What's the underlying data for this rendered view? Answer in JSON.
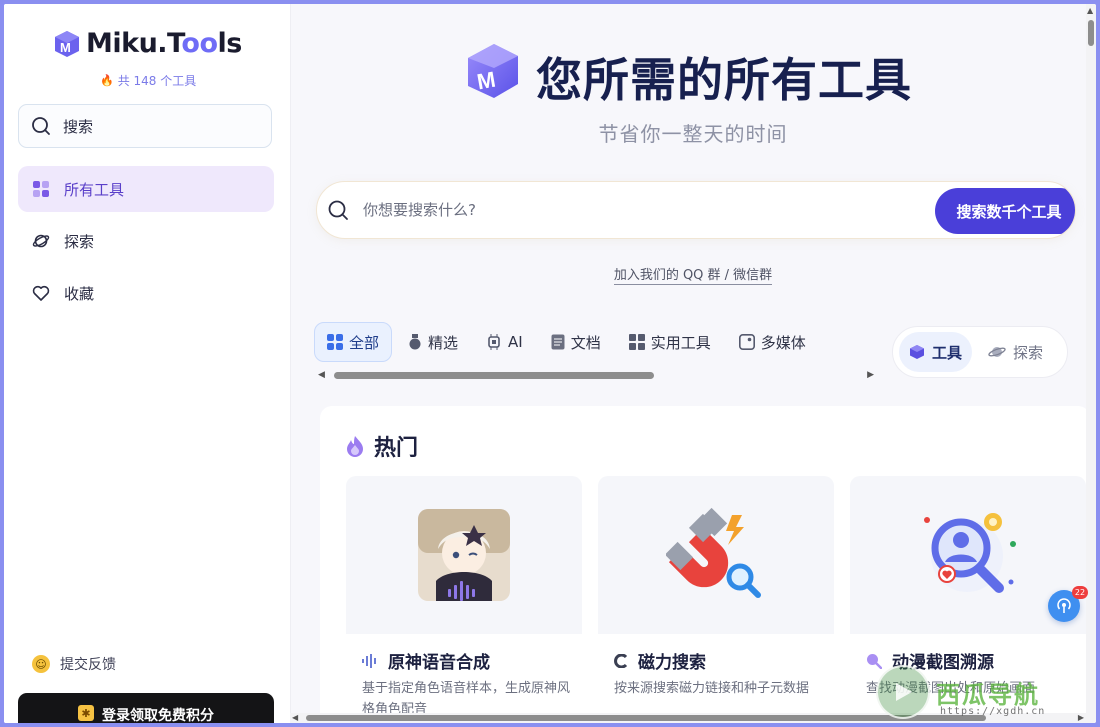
{
  "sidebar": {
    "logo_text_a": "Miku.T",
    "logo_text_b": "o",
    "logo_text_c": "o",
    "logo_text_d": "ls",
    "tool_count": "共 148 个工具",
    "search_label": "搜索",
    "items": [
      {
        "label": "所有工具",
        "icon": "grid-icon",
        "active": true
      },
      {
        "label": "探索",
        "icon": "planet-icon",
        "active": false
      },
      {
        "label": "收藏",
        "icon": "heart-icon",
        "active": false
      }
    ],
    "feedback_label": "提交反馈",
    "login_label": "登录领取免费积分"
  },
  "hero": {
    "title": "您所需的所有工具",
    "subtitle": "节省你一整天的时间"
  },
  "search": {
    "placeholder": "你想要搜索什么?",
    "button_label": "搜索数千个工具"
  },
  "qq_link": "加入我们的 QQ 群 / 微信群",
  "tabs": [
    {
      "label": "全部",
      "icon": "grid-icon",
      "active": true
    },
    {
      "label": "精选",
      "icon": "medal-icon",
      "active": false
    },
    {
      "label": "AI",
      "icon": "chip-icon",
      "active": false
    },
    {
      "label": "文档",
      "icon": "document-icon",
      "active": false
    },
    {
      "label": "实用工具",
      "icon": "apps-icon",
      "active": false
    },
    {
      "label": "多媒体",
      "icon": "media-icon",
      "active": false
    }
  ],
  "modes": [
    {
      "label": "工具",
      "icon": "cube-icon",
      "active": true
    },
    {
      "label": "探索",
      "icon": "planet-icon",
      "active": false
    }
  ],
  "hot": {
    "title": "热门",
    "cards": [
      {
        "name": "原神语音合成",
        "desc": "基于指定角色语音样本，生成原神风格角色配音",
        "icon": "waveform-icon"
      },
      {
        "name": "磁力搜索",
        "desc": "按来源搜索磁力链接和种子元数据",
        "icon": "magnet-icon"
      },
      {
        "name": "动漫截图溯源",
        "desc": "查找动漫截图出处和原始画面",
        "icon": "search-image-icon"
      }
    ]
  },
  "float_badge": "22",
  "watermark": {
    "text": "西瓜导航",
    "url": "https://xgdh.cn"
  },
  "colors": {
    "accent": "#4a3fd9",
    "active_nav_bg": "#efe8fc",
    "title": "#17204f"
  }
}
